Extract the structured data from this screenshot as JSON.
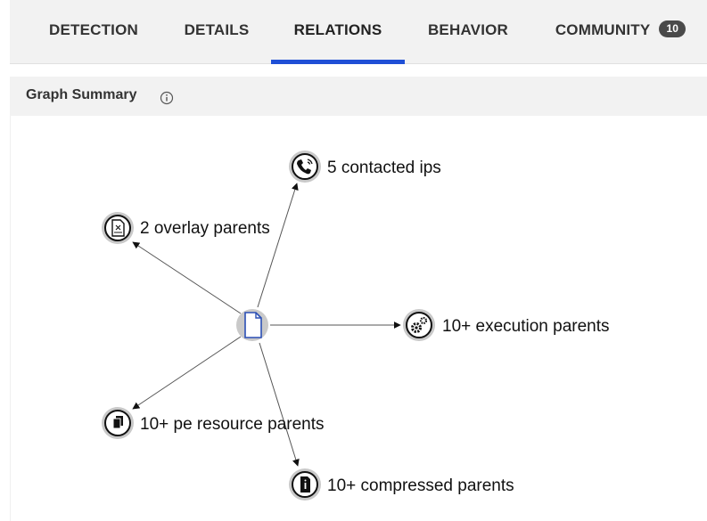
{
  "tabs": [
    {
      "label": "DETECTION",
      "active": false
    },
    {
      "label": "DETAILS",
      "active": false
    },
    {
      "label": "RELATIONS",
      "active": true
    },
    {
      "label": "BEHAVIOR",
      "active": false
    },
    {
      "label": "COMMUNITY",
      "active": false,
      "badge": "10"
    }
  ],
  "accent_color": "#1f4fd6",
  "summary": {
    "title": "Graph Summary",
    "info_icon": "info-icon"
  },
  "graph": {
    "center_icon": "file-icon",
    "nodes": [
      {
        "id": "contacted-ips",
        "label": "5 contacted ips",
        "icon": "phone-icon"
      },
      {
        "id": "overlay-parents",
        "label": "2 overlay parents",
        "icon": "file-archive-icon"
      },
      {
        "id": "execution-parents",
        "label": "10+ execution parents",
        "icon": "gears-icon"
      },
      {
        "id": "pe-resource-parents",
        "label": "10+ pe resource parents",
        "icon": "files-stack-icon"
      },
      {
        "id": "compressed-parents",
        "label": "10+ compressed parents",
        "icon": "file-info-icon"
      }
    ]
  }
}
